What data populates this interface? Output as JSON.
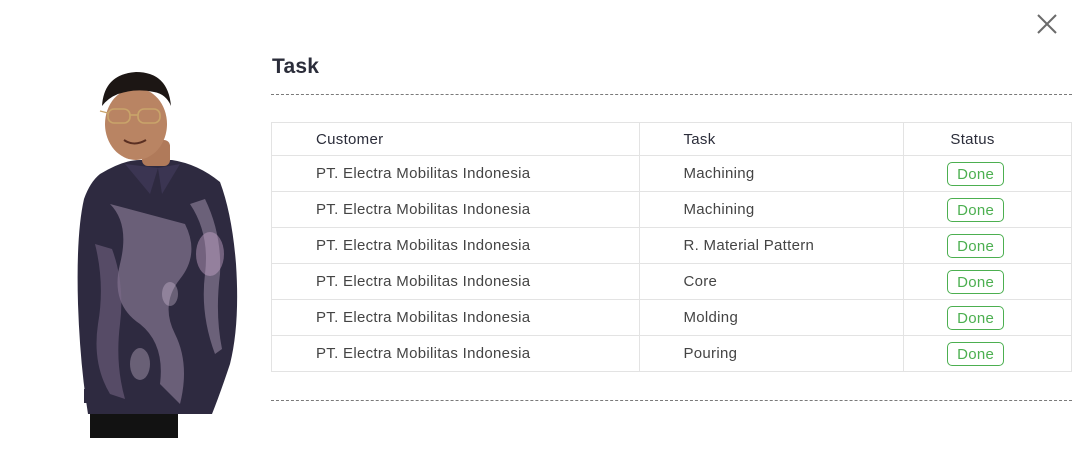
{
  "panel": {
    "title": "Task"
  },
  "table": {
    "headers": {
      "customer": "Customer",
      "task": "Task",
      "status": "Status"
    },
    "rows": [
      {
        "customer": "PT. Electra Mobilitas Indonesia",
        "task": "Machining",
        "status": "Done"
      },
      {
        "customer": "PT. Electra Mobilitas Indonesia",
        "task": "Machining",
        "status": "Done"
      },
      {
        "customer": "PT. Electra Mobilitas Indonesia",
        "task": "R. Material Pattern",
        "status": "Done"
      },
      {
        "customer": "PT. Electra Mobilitas Indonesia",
        "task": "Core",
        "status": "Done"
      },
      {
        "customer": "PT. Electra Mobilitas Indonesia",
        "task": "Molding",
        "status": "Done"
      },
      {
        "customer": "PT. Electra Mobilitas Indonesia",
        "task": "Pouring",
        "status": "Done"
      }
    ]
  },
  "colors": {
    "status_done": "#4caf50",
    "title": "#2b2d3a",
    "border": "#e3e3e3"
  },
  "icons": {
    "close": "close-icon",
    "portrait": "person-photo"
  }
}
